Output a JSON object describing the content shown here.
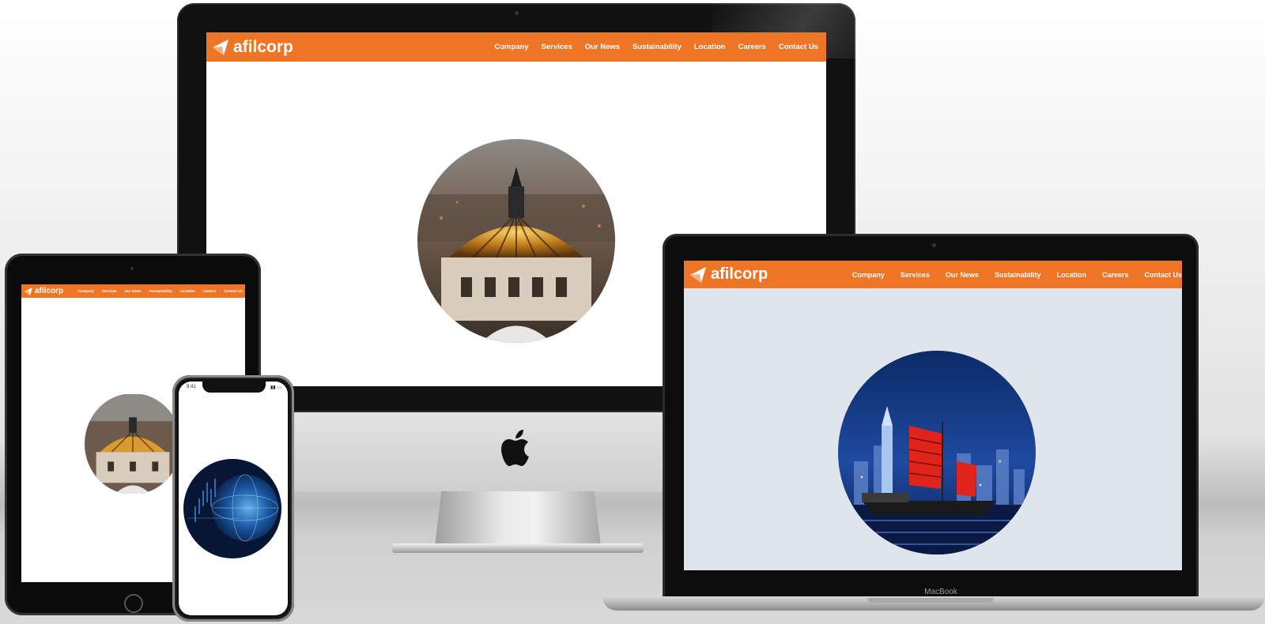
{
  "brand": {
    "name": "afilcorp",
    "color": "#ef7526"
  },
  "nav": {
    "items": [
      "Company",
      "Services",
      "Our News",
      "Sustainability",
      "Location",
      "Careers",
      "Contact Us"
    ]
  },
  "devices": {
    "desktop": {
      "hero_image": "palace-dome-aerial-photo",
      "screen_bg": "#ffffff"
    },
    "laptop": {
      "hero_image": "junk-boat-harbor-night-photo",
      "screen_bg": "#dfe5ec",
      "label": "MacBook"
    },
    "tablet": {
      "hero_image": "palace-dome-aerial-photo",
      "screen_bg": "#ffffff"
    },
    "phone": {
      "hero_image": "digital-globe-finance-photo",
      "status_time": "9:41"
    }
  },
  "icons": {
    "apple_logo": "apple-logo-icon",
    "logo_mark": "afilcorp-logo-mark-icon"
  }
}
